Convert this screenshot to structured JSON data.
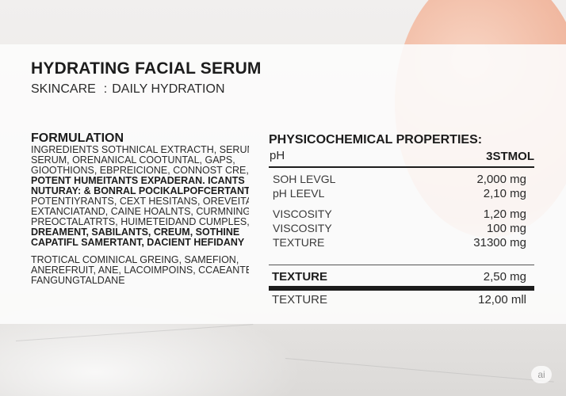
{
  "product": {
    "title": "HYDRATING FACIAL SERUM",
    "category": "SKINCARE",
    "separator": ":",
    "tagline": "DAILY HYDRATION"
  },
  "formulation": {
    "heading": "FORMULATION",
    "lines": [
      "INGREDIENTS SOTHNICAL EXTRACTH, SERUM",
      "SERUM,  ORENANICAL COOTUNTAL,  GAPS,",
      "GIOOTHIONS, EBPREICIONE,  CONNOST CRE,",
      "POTENT HUMEITANTS EXPADERAN. ICANTS",
      "NUTURAY: & BONRAL POCIKALPOFCERTANTS",
      "POTENTIYRANTS, CEXT HESITANS, OREVEITA,",
      "EXTANCIATAND, CAINE HOALNTS, CURMNING",
      "PREOCTALATRTS, HUIMETEIDAND CUMPLES,",
      "DREAMENT, SABILANTS, CREUM, SOTHINE",
      "CAPATIFL SAMERTANT, DACIENT HEFIDANY",
      "TROTICAL  COMINICAL GREING, SAMEFION,",
      "ANEREFRUIT, ANE, LACOIMPOINS, CCAEANTE,",
      "FANGUNGTALDANE"
    ]
  },
  "properties": {
    "heading": "PHYSICOCHEMICAL PROPERTIES:",
    "col_left": "pH",
    "col_right": "3STMOL",
    "rows": [
      {
        "label": "SOH LEVGL",
        "value": "2,000 mg"
      },
      {
        "label": "pH LEEVL",
        "value": "2,10 mg"
      },
      {
        "label": "VISCOSITY",
        "value": "1,20 mg"
      },
      {
        "label": "VISCOSITY",
        "value": "100 mg"
      },
      {
        "label": "TEXTURE",
        "value": "31300 mg"
      }
    ],
    "texture_bold": {
      "label": "TEXTURE",
      "value": "2,50 mg"
    },
    "texture_last": {
      "label": "TEXTURE",
      "value": "12,00 mll"
    }
  },
  "badge": "ai"
}
